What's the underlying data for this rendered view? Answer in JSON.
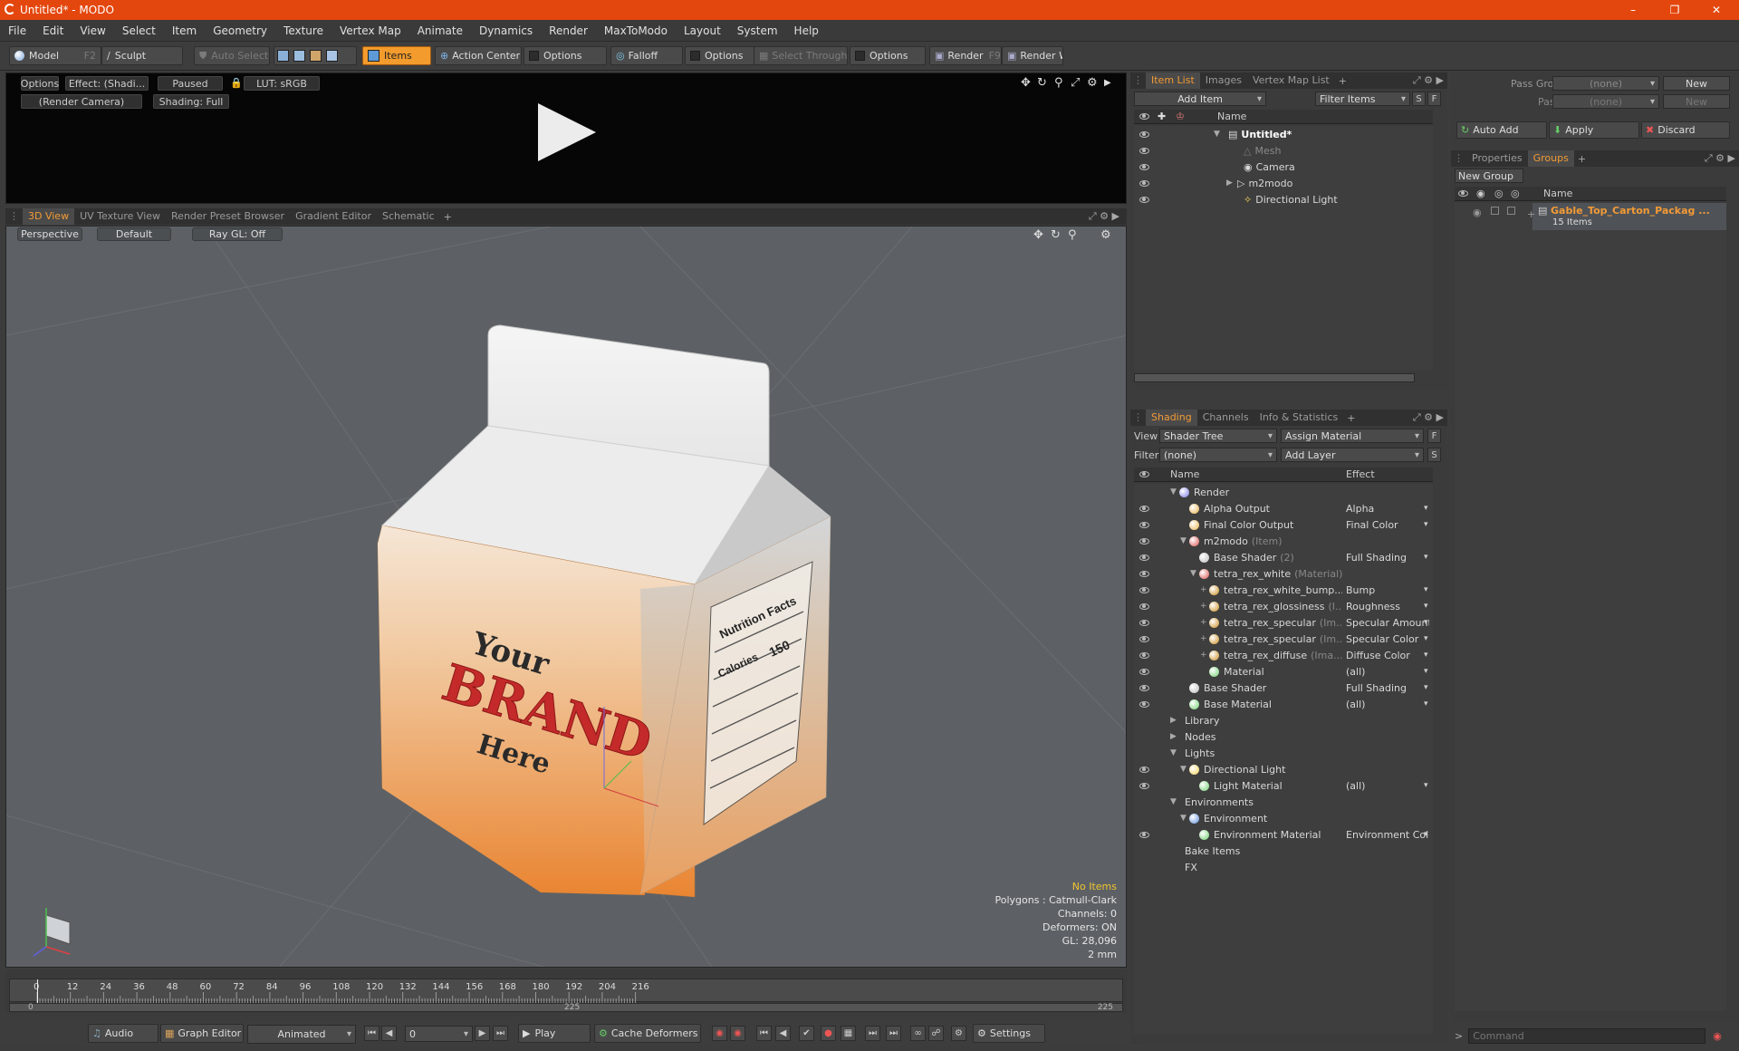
{
  "app": {
    "title": "Untitled* - MODO"
  },
  "menu": [
    "File",
    "Edit",
    "View",
    "Select",
    "Item",
    "Geometry",
    "Texture",
    "Vertex Map",
    "Animate",
    "Dynamics",
    "Render",
    "MaxToModo",
    "Layout",
    "System",
    "Help"
  ],
  "toolbar": {
    "model": "Model",
    "model_key": "F2",
    "sculpt": "Sculpt",
    "auto_select": "Auto Select",
    "items": "Items",
    "action_center": "Action Center",
    "options": "Options",
    "falloff": "Falloff",
    "select_through": "Select Through",
    "render": "Render",
    "render_key": "F9",
    "render_window": "Render Window"
  },
  "preview": {
    "options": "Options",
    "effect": "Effect: (Shadi...",
    "paused": "Paused",
    "lut": "LUT: sRGB",
    "camera": "(Render Camera)",
    "shading": "Shading: Full"
  },
  "viewport_tabs": [
    "3D View",
    "UV Texture View",
    "Render Preset Browser",
    "Gradient Editor",
    "Schematic"
  ],
  "viewport": {
    "perspective": "Perspective",
    "default": "Default",
    "raygl": "Ray GL: Off"
  },
  "stats": {
    "no_items": "No Items",
    "polygons": "Polygons : Catmull-Clark",
    "channels": "Channels: 0",
    "deformers": "Deformers: ON",
    "gl": "GL: 28,096",
    "scale": "2 mm"
  },
  "carton": {
    "line1": "Your",
    "line2": "BRAND",
    "line3": "Here",
    "side_title": "Nutrition Facts",
    "calories": "Calories",
    "cal_value": "150"
  },
  "timeline": {
    "ticks": [
      "0",
      "12",
      "24",
      "36",
      "48",
      "60",
      "72",
      "84",
      "96",
      "108",
      "120",
      "132",
      "144",
      "156",
      "168",
      "180",
      "192",
      "204",
      "216"
    ],
    "start": "0",
    "mid": "225",
    "end": "225"
  },
  "transport": {
    "audio": "Audio",
    "graph_editor": "Graph Editor",
    "animated": "Animated",
    "frame": "0",
    "play": "Play",
    "cache": "Cache Deformers",
    "settings": "Settings"
  },
  "itemlist": {
    "tabs": [
      "Item List",
      "Images",
      "Vertex Map List"
    ],
    "add_item": "Add Item",
    "filter": "Filter Items",
    "s": "S",
    "f": "F",
    "name_col": "Name",
    "items": [
      {
        "name": "Untitled*",
        "bold": true
      },
      {
        "name": "Mesh",
        "dim": true
      },
      {
        "name": "Camera"
      },
      {
        "name": "m2modo"
      },
      {
        "name": "Directional Light"
      }
    ]
  },
  "shading": {
    "tabs": [
      "Shading",
      "Channels",
      "Info & Statistics"
    ],
    "view_label": "View",
    "view": "Shader Tree",
    "assign": "Assign Material",
    "filter_label": "Filter",
    "filter": "(none)",
    "add_layer": "Add Layer",
    "name_col": "Name",
    "effect_col": "Effect",
    "rows": [
      {
        "name": "Render",
        "suffix": "",
        "effect": ""
      },
      {
        "name": "Alpha Output",
        "suffix": "",
        "effect": "Alpha"
      },
      {
        "name": "Final Color Output",
        "suffix": "",
        "effect": "Final Color"
      },
      {
        "name": "m2modo",
        "suffix": "(Item)",
        "effect": ""
      },
      {
        "name": "Base Shader",
        "suffix": "(2)",
        "effect": "Full Shading"
      },
      {
        "name": "tetra_rex_white",
        "suffix": "(Material)",
        "effect": ""
      },
      {
        "name": "tetra_rex_white_bump...",
        "suffix": "",
        "effect": "Bump"
      },
      {
        "name": "tetra_rex_glossiness",
        "suffix": "(I...",
        "effect": "Roughness"
      },
      {
        "name": "tetra_rex_specular",
        "suffix": "(Im...",
        "effect": "Specular Amount"
      },
      {
        "name": "tetra_rex_specular",
        "suffix": "(Im...",
        "effect": "Specular Color"
      },
      {
        "name": "tetra_rex_diffuse",
        "suffix": "(Ima...",
        "effect": "Diffuse Color"
      },
      {
        "name": "Material",
        "suffix": "",
        "effect": "(all)"
      },
      {
        "name": "Base Shader",
        "suffix": "",
        "effect": "Full Shading"
      },
      {
        "name": "Base Material",
        "suffix": "",
        "effect": "(all)"
      },
      {
        "name": "Library",
        "suffix": "",
        "effect": ""
      },
      {
        "name": "Nodes",
        "suffix": "",
        "effect": ""
      },
      {
        "name": "Lights",
        "suffix": "",
        "effect": ""
      },
      {
        "name": "Directional Light",
        "suffix": "",
        "effect": ""
      },
      {
        "name": "Light Material",
        "suffix": "",
        "effect": "(all)"
      },
      {
        "name": "Environments",
        "suffix": "",
        "effect": ""
      },
      {
        "name": "Environment",
        "suffix": "",
        "effect": ""
      },
      {
        "name": "Environment Material",
        "suffix": "",
        "effect": "Environment Color"
      },
      {
        "name": "Bake Items",
        "suffix": "",
        "effect": ""
      },
      {
        "name": "FX",
        "suffix": "",
        "effect": ""
      }
    ]
  },
  "groups": {
    "pass_groups": "Pass Groups",
    "pass_groups_val": "(none)",
    "new": "New",
    "passes": "Passes",
    "passes_val": "(none)",
    "new2": "New",
    "auto_add": "Auto Add",
    "apply": "Apply",
    "discard": "Discard",
    "tabs": [
      "Properties",
      "Groups"
    ],
    "new_group": "New Group",
    "name_col": "Name",
    "group_name": "Gable_Top_Carton_Packag ...",
    "group_count": "15 Items"
  },
  "command": {
    "placeholder": "Command"
  }
}
